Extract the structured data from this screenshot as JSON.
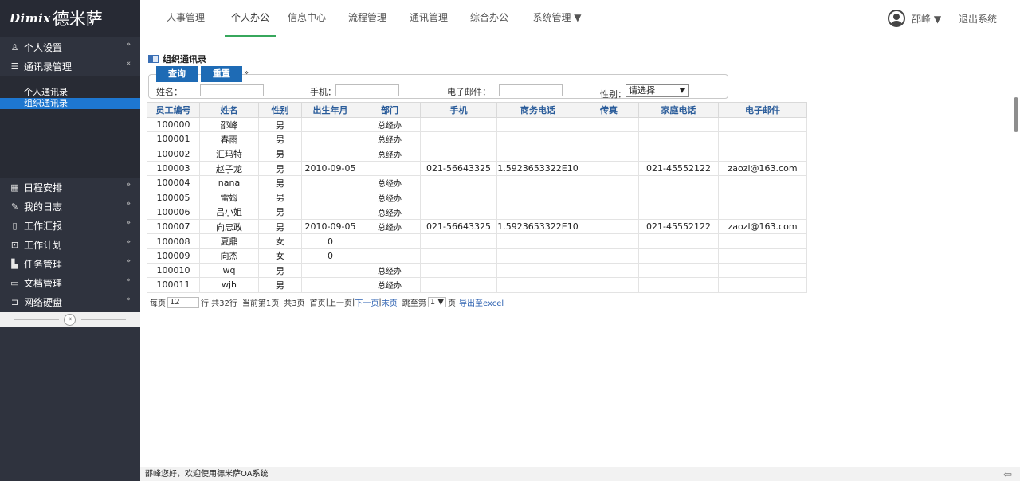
{
  "brand": {
    "latin": "Dimix",
    "cjk": "德米萨"
  },
  "sidebar": {
    "items": [
      {
        "label": "个人设置",
        "icon": "user-icon",
        "chevron": "»"
      },
      {
        "label": "通讯录管理",
        "icon": "list-icon",
        "chevron": "«"
      }
    ],
    "submenu": [
      {
        "label": "个人通讯录"
      },
      {
        "label": "组织通讯录"
      }
    ],
    "items_after": [
      {
        "label": "日程安排",
        "icon": "calendar-icon",
        "chevron": "»"
      },
      {
        "label": "我的日志",
        "icon": "pencil-icon",
        "chevron": "»"
      },
      {
        "label": "工作汇报",
        "icon": "document-icon",
        "chevron": "»"
      },
      {
        "label": "工作计划",
        "icon": "plan-icon",
        "chevron": "»"
      },
      {
        "label": "任务管理",
        "icon": "task-icon",
        "chevron": "»"
      },
      {
        "label": "文档管理",
        "icon": "folder-icon",
        "chevron": "»"
      },
      {
        "label": "网络硬盘",
        "icon": "folder-open-icon",
        "chevron": "»"
      }
    ],
    "collapse_symbol": "«"
  },
  "topnav": {
    "tabs": [
      {
        "label": "人事管理"
      },
      {
        "label": "个人办公"
      },
      {
        "label": "信息中心"
      },
      {
        "label": "流程管理"
      },
      {
        "label": "通讯管理"
      },
      {
        "label": "综合办公"
      },
      {
        "label": "系统管理 ▼"
      }
    ],
    "user_name": "邵峰 ▼",
    "logout": "退出系统",
    "accent_color": "#37a75c"
  },
  "content": {
    "title": "组织通讯录",
    "buttons": {
      "query": "查询",
      "reset": "重置",
      "expand": "»"
    },
    "form": {
      "name_label": "姓名：",
      "mobile_label": "手机：",
      "email_label": "电子邮件：",
      "gender_label": "性别：",
      "gender_selected": "请选择",
      "name_value": "",
      "mobile_value": "",
      "email_value": ""
    },
    "table": {
      "headers": [
        "员工编号",
        "姓名",
        "性别",
        "出生年月",
        "部门",
        "手机",
        "商务电话",
        "传真",
        "家庭电话",
        "电子邮件"
      ],
      "rows": [
        [
          "100000",
          "邵峰",
          "男",
          "",
          "总经办",
          "",
          "",
          "",
          "",
          ""
        ],
        [
          "100001",
          "春雨",
          "男",
          "",
          "总经办",
          "",
          "",
          "",
          "",
          ""
        ],
        [
          "100002",
          "汇玛特",
          "男",
          "",
          "总经办",
          "",
          "",
          "",
          "",
          ""
        ],
        [
          "100003",
          "赵子龙",
          "男",
          "2010-09-05",
          "",
          "021-56643325",
          "1.5923653322E10",
          "",
          "021-45552122",
          "zaozl@163.com"
        ],
        [
          "100004",
          "nana",
          "男",
          "",
          "总经办",
          "",
          "",
          "",
          "",
          ""
        ],
        [
          "100005",
          "雷姆",
          "男",
          "",
          "总经办",
          "",
          "",
          "",
          "",
          ""
        ],
        [
          "100006",
          "吕小姐",
          "男",
          "",
          "总经办",
          "",
          "",
          "",
          "",
          ""
        ],
        [
          "100007",
          "向忠政",
          "男",
          "2010-09-05",
          "总经办",
          "021-56643325",
          "1.5923653322E10",
          "",
          "021-45552122",
          "zaozl@163.com"
        ],
        [
          "100008",
          "夏鼎",
          "女",
          "0",
          "",
          "",
          "",
          "",
          "",
          ""
        ],
        [
          "100009",
          "向杰",
          "女",
          "0",
          "",
          "",
          "",
          "",
          "",
          ""
        ],
        [
          "100010",
          "wq",
          "男",
          "",
          "总经办",
          "",
          "",
          "",
          "",
          ""
        ],
        [
          "100011",
          "wjh",
          "男",
          "",
          "总经办",
          "",
          "",
          "",
          "",
          ""
        ]
      ]
    },
    "pager": {
      "per_page_label": "每页",
      "per_page_value": "12",
      "total": "行 共32行",
      "current": "当前第1页",
      "pages": "共3页",
      "first": "首页",
      "prev": "上一页",
      "next": "下一页",
      "last": "末页",
      "jump_label": "跳至第",
      "jump_value": "1 ▼",
      "page_suffix": "页",
      "export": "导出至excel",
      "sep": "|"
    }
  },
  "footer": {
    "text": "邵峰您好，欢迎使用德米萨OA系统",
    "icon": "⇦"
  }
}
